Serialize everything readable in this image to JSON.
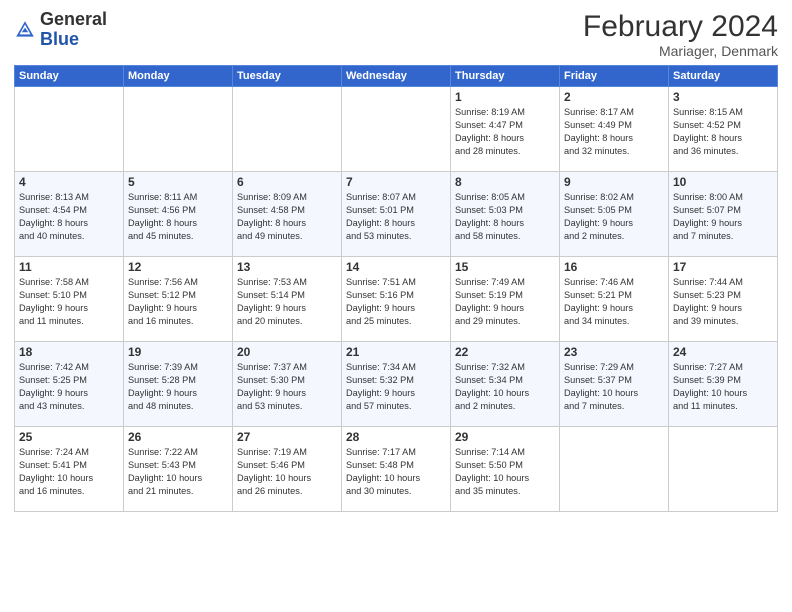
{
  "header": {
    "logo_general": "General",
    "logo_blue": "Blue",
    "month_title": "February 2024",
    "location": "Mariager, Denmark"
  },
  "weekdays": [
    "Sunday",
    "Monday",
    "Tuesday",
    "Wednesday",
    "Thursday",
    "Friday",
    "Saturday"
  ],
  "weeks": [
    [
      {
        "day": "",
        "info": ""
      },
      {
        "day": "",
        "info": ""
      },
      {
        "day": "",
        "info": ""
      },
      {
        "day": "",
        "info": ""
      },
      {
        "day": "1",
        "info": "Sunrise: 8:19 AM\nSunset: 4:47 PM\nDaylight: 8 hours\nand 28 minutes."
      },
      {
        "day": "2",
        "info": "Sunrise: 8:17 AM\nSunset: 4:49 PM\nDaylight: 8 hours\nand 32 minutes."
      },
      {
        "day": "3",
        "info": "Sunrise: 8:15 AM\nSunset: 4:52 PM\nDaylight: 8 hours\nand 36 minutes."
      }
    ],
    [
      {
        "day": "4",
        "info": "Sunrise: 8:13 AM\nSunset: 4:54 PM\nDaylight: 8 hours\nand 40 minutes."
      },
      {
        "day": "5",
        "info": "Sunrise: 8:11 AM\nSunset: 4:56 PM\nDaylight: 8 hours\nand 45 minutes."
      },
      {
        "day": "6",
        "info": "Sunrise: 8:09 AM\nSunset: 4:58 PM\nDaylight: 8 hours\nand 49 minutes."
      },
      {
        "day": "7",
        "info": "Sunrise: 8:07 AM\nSunset: 5:01 PM\nDaylight: 8 hours\nand 53 minutes."
      },
      {
        "day": "8",
        "info": "Sunrise: 8:05 AM\nSunset: 5:03 PM\nDaylight: 8 hours\nand 58 minutes."
      },
      {
        "day": "9",
        "info": "Sunrise: 8:02 AM\nSunset: 5:05 PM\nDaylight: 9 hours\nand 2 minutes."
      },
      {
        "day": "10",
        "info": "Sunrise: 8:00 AM\nSunset: 5:07 PM\nDaylight: 9 hours\nand 7 minutes."
      }
    ],
    [
      {
        "day": "11",
        "info": "Sunrise: 7:58 AM\nSunset: 5:10 PM\nDaylight: 9 hours\nand 11 minutes."
      },
      {
        "day": "12",
        "info": "Sunrise: 7:56 AM\nSunset: 5:12 PM\nDaylight: 9 hours\nand 16 minutes."
      },
      {
        "day": "13",
        "info": "Sunrise: 7:53 AM\nSunset: 5:14 PM\nDaylight: 9 hours\nand 20 minutes."
      },
      {
        "day": "14",
        "info": "Sunrise: 7:51 AM\nSunset: 5:16 PM\nDaylight: 9 hours\nand 25 minutes."
      },
      {
        "day": "15",
        "info": "Sunrise: 7:49 AM\nSunset: 5:19 PM\nDaylight: 9 hours\nand 29 minutes."
      },
      {
        "day": "16",
        "info": "Sunrise: 7:46 AM\nSunset: 5:21 PM\nDaylight: 9 hours\nand 34 minutes."
      },
      {
        "day": "17",
        "info": "Sunrise: 7:44 AM\nSunset: 5:23 PM\nDaylight: 9 hours\nand 39 minutes."
      }
    ],
    [
      {
        "day": "18",
        "info": "Sunrise: 7:42 AM\nSunset: 5:25 PM\nDaylight: 9 hours\nand 43 minutes."
      },
      {
        "day": "19",
        "info": "Sunrise: 7:39 AM\nSunset: 5:28 PM\nDaylight: 9 hours\nand 48 minutes."
      },
      {
        "day": "20",
        "info": "Sunrise: 7:37 AM\nSunset: 5:30 PM\nDaylight: 9 hours\nand 53 minutes."
      },
      {
        "day": "21",
        "info": "Sunrise: 7:34 AM\nSunset: 5:32 PM\nDaylight: 9 hours\nand 57 minutes."
      },
      {
        "day": "22",
        "info": "Sunrise: 7:32 AM\nSunset: 5:34 PM\nDaylight: 10 hours\nand 2 minutes."
      },
      {
        "day": "23",
        "info": "Sunrise: 7:29 AM\nSunset: 5:37 PM\nDaylight: 10 hours\nand 7 minutes."
      },
      {
        "day": "24",
        "info": "Sunrise: 7:27 AM\nSunset: 5:39 PM\nDaylight: 10 hours\nand 11 minutes."
      }
    ],
    [
      {
        "day": "25",
        "info": "Sunrise: 7:24 AM\nSunset: 5:41 PM\nDaylight: 10 hours\nand 16 minutes."
      },
      {
        "day": "26",
        "info": "Sunrise: 7:22 AM\nSunset: 5:43 PM\nDaylight: 10 hours\nand 21 minutes."
      },
      {
        "day": "27",
        "info": "Sunrise: 7:19 AM\nSunset: 5:46 PM\nDaylight: 10 hours\nand 26 minutes."
      },
      {
        "day": "28",
        "info": "Sunrise: 7:17 AM\nSunset: 5:48 PM\nDaylight: 10 hours\nand 30 minutes."
      },
      {
        "day": "29",
        "info": "Sunrise: 7:14 AM\nSunset: 5:50 PM\nDaylight: 10 hours\nand 35 minutes."
      },
      {
        "day": "",
        "info": ""
      },
      {
        "day": "",
        "info": ""
      }
    ]
  ]
}
